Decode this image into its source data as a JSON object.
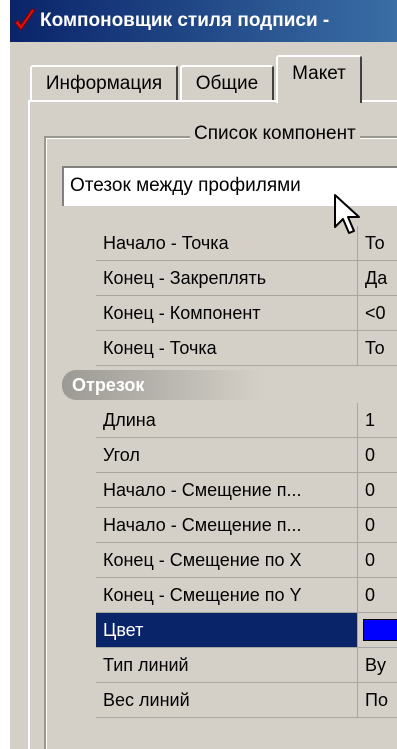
{
  "window": {
    "title": "Компоновщик стиля подписи -"
  },
  "tabs": [
    {
      "label": "Информация"
    },
    {
      "label": "Общие"
    },
    {
      "label": "Макет"
    }
  ],
  "group": {
    "title": "Список компонент"
  },
  "combo": {
    "value": "Отезок между профилями"
  },
  "properties": [
    {
      "name": "Начало - Точка",
      "value": "То"
    },
    {
      "name": "Конец - Закреплять",
      "value": "Да"
    },
    {
      "name": "Конец - Компонент",
      "value": "<0"
    },
    {
      "name": "Конец - Точка",
      "value": "То"
    }
  ],
  "section": {
    "label": "Отрезок"
  },
  "segment_properties": [
    {
      "name": "Длина",
      "value": "1"
    },
    {
      "name": "Угол",
      "value": "0"
    },
    {
      "name": "Начало - Смещение п...",
      "value": "0"
    },
    {
      "name": "Начало - Смещение п...",
      "value": "0"
    },
    {
      "name": "Конец - Смещение по X",
      "value": "0"
    },
    {
      "name": "Конец - Смещение по Y",
      "value": "0"
    },
    {
      "name": "Цвет",
      "value": "",
      "color": "#0000ff",
      "selected": true
    },
    {
      "name": "Тип линий",
      "value": "By"
    },
    {
      "name": "Вес линий",
      "value": "По"
    }
  ],
  "colors": {
    "title_bar": "#0a246a",
    "selection": "#0a246a",
    "color_swatch": "#0000ff"
  },
  "icons": {
    "title": "red-checkmark-icon",
    "cursor": "mouse-pointer-icon"
  }
}
